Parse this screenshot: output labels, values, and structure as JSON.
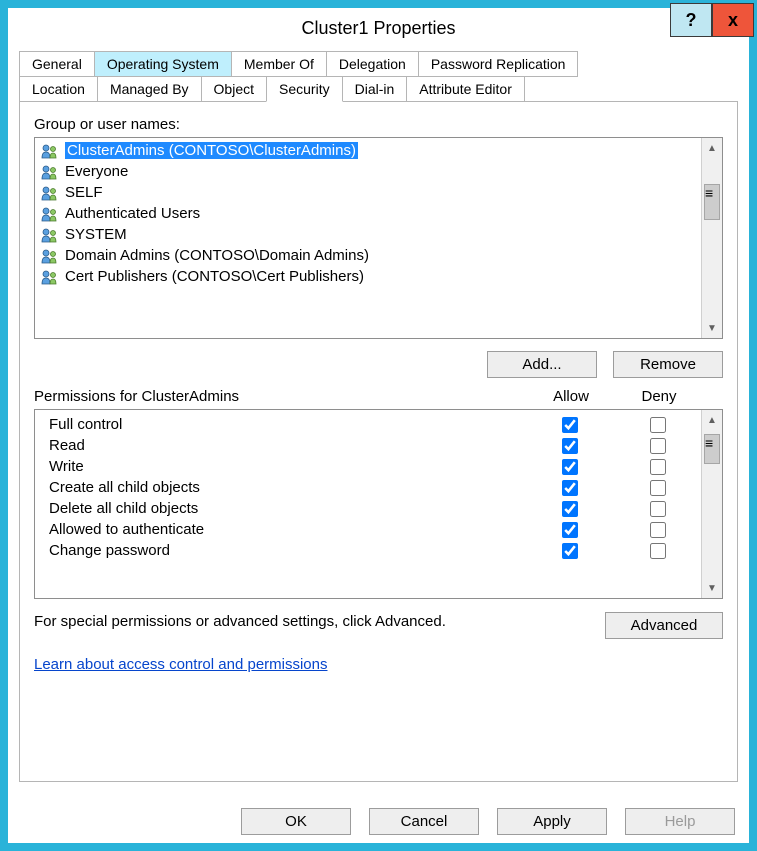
{
  "title": "Cluster1 Properties",
  "titlebar": {
    "help": "?",
    "close": "x"
  },
  "tabs_row1": [
    {
      "id": "general",
      "label": "General"
    },
    {
      "id": "os",
      "label": "Operating System",
      "highlight": true
    },
    {
      "id": "memberof",
      "label": "Member Of"
    },
    {
      "id": "delegation",
      "label": "Delegation"
    },
    {
      "id": "pwdrep",
      "label": "Password Replication"
    }
  ],
  "tabs_row2": [
    {
      "id": "location",
      "label": "Location"
    },
    {
      "id": "managedby",
      "label": "Managed By"
    },
    {
      "id": "object",
      "label": "Object"
    },
    {
      "id": "security",
      "label": "Security",
      "active": true
    },
    {
      "id": "dialin",
      "label": "Dial-in"
    },
    {
      "id": "attr",
      "label": "Attribute Editor"
    }
  ],
  "labels": {
    "group_users": "Group or user names:",
    "permissions_for": "Permissions for ClusterAdmins",
    "allow": "Allow",
    "deny": "Deny",
    "note": "For special permissions or advanced settings, click Advanced.",
    "link": "Learn about access control and permissions"
  },
  "buttons": {
    "add": "Add...",
    "remove": "Remove",
    "advanced": "Advanced",
    "ok": "OK",
    "cancel": "Cancel",
    "apply": "Apply",
    "help": "Help"
  },
  "principals": [
    {
      "name": "ClusterAdmins (CONTOSO\\ClusterAdmins)",
      "icon": "users-icon",
      "selected": true
    },
    {
      "name": "Everyone",
      "icon": "users-icon"
    },
    {
      "name": "SELF",
      "icon": "users-icon"
    },
    {
      "name": "Authenticated Users",
      "icon": "users-icon"
    },
    {
      "name": "SYSTEM",
      "icon": "users-icon"
    },
    {
      "name": "Domain Admins (CONTOSO\\Domain Admins)",
      "icon": "users-icon"
    },
    {
      "name": "Cert Publishers (CONTOSO\\Cert Publishers)",
      "icon": "users-icon"
    }
  ],
  "permissions": [
    {
      "name": "Full control",
      "allow": true,
      "deny": false
    },
    {
      "name": "Read",
      "allow": true,
      "deny": false
    },
    {
      "name": "Write",
      "allow": true,
      "deny": false
    },
    {
      "name": "Create all child objects",
      "allow": true,
      "deny": false
    },
    {
      "name": "Delete all child objects",
      "allow": true,
      "deny": false
    },
    {
      "name": "Allowed to authenticate",
      "allow": true,
      "deny": false
    },
    {
      "name": "Change password",
      "allow": true,
      "deny": false
    }
  ]
}
